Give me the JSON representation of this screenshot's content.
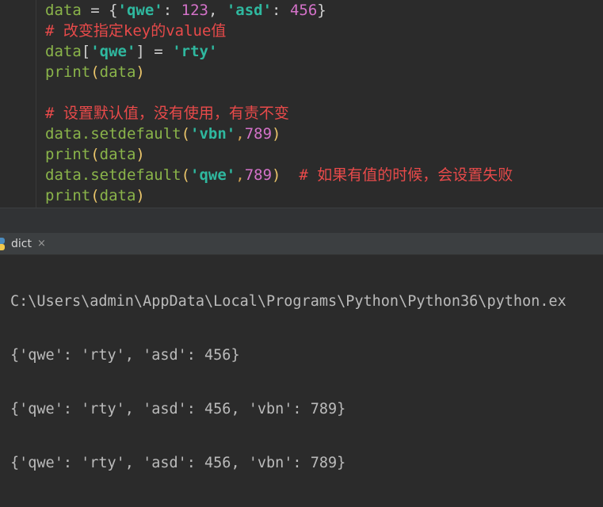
{
  "editor": {
    "lines": [
      [
        {
          "t": "data",
          "c": "var"
        },
        {
          "t": " = {",
          "c": "punc"
        },
        {
          "t": "'qwe'",
          "c": "str"
        },
        {
          "t": ": ",
          "c": "punc"
        },
        {
          "t": "123",
          "c": "num"
        },
        {
          "t": ", ",
          "c": "punc"
        },
        {
          "t": "'asd'",
          "c": "str"
        },
        {
          "t": ": ",
          "c": "punc"
        },
        {
          "t": "456",
          "c": "num"
        },
        {
          "t": "}",
          "c": "punc"
        }
      ],
      [
        {
          "t": "# 改变指定key的value值",
          "c": "comment"
        }
      ],
      [
        {
          "t": "data",
          "c": "var"
        },
        {
          "t": "[",
          "c": "punc"
        },
        {
          "t": "'qwe'",
          "c": "str"
        },
        {
          "t": "] = ",
          "c": "punc"
        },
        {
          "t": "'rty'",
          "c": "str"
        }
      ],
      [
        {
          "t": "print",
          "c": "fn"
        },
        {
          "t": "(",
          "c": "paren"
        },
        {
          "t": "data",
          "c": "var"
        },
        {
          "t": ")",
          "c": "paren"
        }
      ],
      [],
      [
        {
          "t": "# 设置默认值，没有使用，有责不变",
          "c": "comment"
        }
      ],
      [
        {
          "t": "data.setdefault",
          "c": "var"
        },
        {
          "t": "(",
          "c": "paren"
        },
        {
          "t": "'vbn'",
          "c": "str"
        },
        {
          "t": ",",
          "c": "comma"
        },
        {
          "t": "789",
          "c": "num"
        },
        {
          "t": ")",
          "c": "paren"
        }
      ],
      [
        {
          "t": "print",
          "c": "fn"
        },
        {
          "t": "(",
          "c": "paren"
        },
        {
          "t": "data",
          "c": "var"
        },
        {
          "t": ")",
          "c": "paren"
        }
      ],
      [
        {
          "t": "data.setdefault",
          "c": "var"
        },
        {
          "t": "(",
          "c": "paren"
        },
        {
          "t": "'qwe'",
          "c": "str"
        },
        {
          "t": ",",
          "c": "comma"
        },
        {
          "t": "789",
          "c": "num"
        },
        {
          "t": ")",
          "c": "paren"
        },
        {
          "t": "  # 如果有值的时候，会设置失败",
          "c": "comment"
        }
      ],
      [
        {
          "t": "print",
          "c": "fn"
        },
        {
          "t": "(",
          "c": "paren"
        },
        {
          "t": "data",
          "c": "var"
        },
        {
          "t": ")",
          "c": "paren"
        }
      ]
    ]
  },
  "run": {
    "tab_label": "dict",
    "tab_close": "×",
    "output": [
      "C:\\Users\\admin\\AppData\\Local\\Programs\\Python\\Python36\\python.ex",
      "{'qwe': 'rty', 'asd': 456}",
      "{'qwe': 'rty', 'asd': 456, 'vbn': 789}",
      "{'qwe': 'rty', 'asd': 456, 'vbn': 789}"
    ]
  },
  "colors": {
    "background": "#2b2b2b",
    "variable": "#8ab44a",
    "string": "#2fb89f",
    "number": "#d472c9",
    "comment": "#e84a4a",
    "output_text": "#bbbbbb"
  }
}
